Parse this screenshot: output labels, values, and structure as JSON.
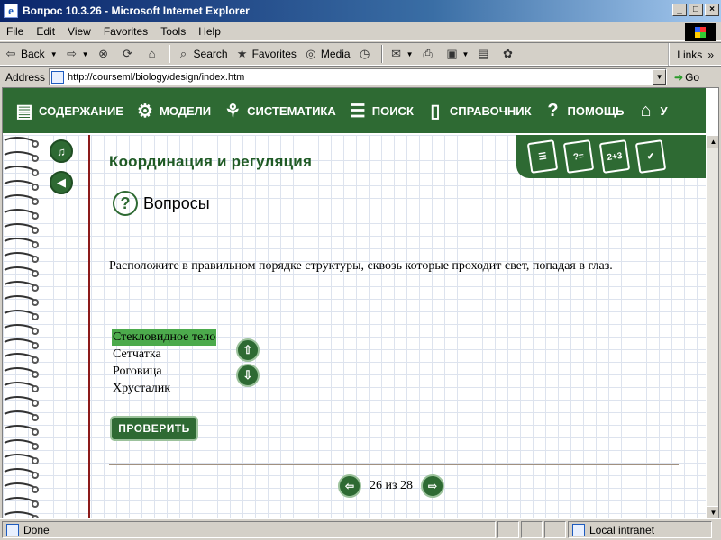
{
  "window": {
    "title": "Вопрос 10.3.26 - Microsoft Internet Explorer"
  },
  "menu": {
    "items": [
      "File",
      "Edit",
      "View",
      "Favorites",
      "Tools",
      "Help"
    ]
  },
  "toolbar": {
    "back": "Back",
    "search": "Search",
    "favorites": "Favorites",
    "media": "Media",
    "links": "Links"
  },
  "address": {
    "label": "Address",
    "url": "http://courseml/biology/design/index.htm",
    "go": "Go"
  },
  "nav": {
    "items": [
      {
        "label": "СОДЕРЖАНИЕ",
        "icon": "notebook-icon"
      },
      {
        "label": "МОДЕЛИ",
        "icon": "gears-icon"
      },
      {
        "label": "СИСТЕМАТИКА",
        "icon": "tree-icon"
      },
      {
        "label": "ПОИСК",
        "icon": "search-document-icon"
      },
      {
        "label": "СПРАВОЧНИК",
        "icon": "book-icon"
      },
      {
        "label": "ПОМОЩЬ",
        "icon": "question-icon"
      },
      {
        "label": "У",
        "icon": "graduation-cap-icon"
      }
    ]
  },
  "lesson": {
    "heading": "Координация и регуляция",
    "section_title": "Вопросы",
    "task_text": "Расположите в правильном порядке структуры, сквозь которые проходит свет, попадая в глаз.",
    "options": [
      "Стекловидное тело",
      "Сетчатка",
      "Роговица",
      "Хрусталик"
    ],
    "selected_index": 0,
    "check_label": "ПРОВЕРИТЬ",
    "pager": {
      "current": 26,
      "total": 28,
      "text": "26 из 28"
    }
  },
  "status": {
    "text": "Done",
    "zone": "Local intranet"
  },
  "colors": {
    "accent_green": "#2e6a33",
    "selection_green": "#4caa4c",
    "margin_red": "#8b1a1a"
  }
}
